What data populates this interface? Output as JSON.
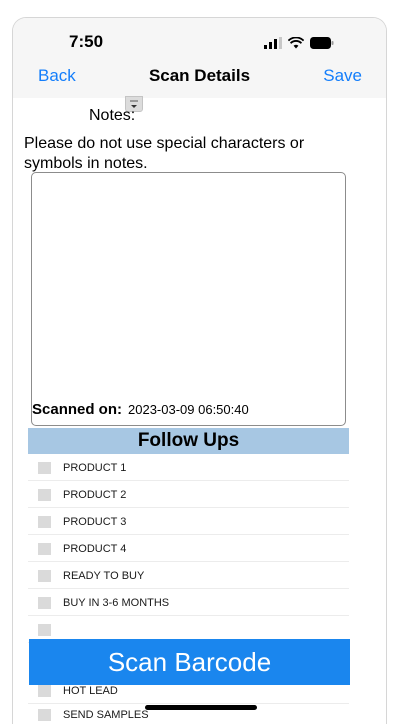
{
  "status_bar": {
    "time": "7:50"
  },
  "nav": {
    "back_label": "Back",
    "title": "Scan Details",
    "save_label": "Save"
  },
  "notes": {
    "label": "Notes:",
    "help_text": "Please do not use special characters or symbols in notes.",
    "value": ""
  },
  "scanned": {
    "label": "Scanned  on:",
    "value": "2023-03-09 06:50:40"
  },
  "followups": {
    "title": "Follow Ups",
    "items": [
      {
        "label": "PRODUCT 1",
        "checked": false
      },
      {
        "label": "PRODUCT 2",
        "checked": false
      },
      {
        "label": "PRODUCT 3",
        "checked": false
      },
      {
        "label": "PRODUCT 4",
        "checked": false
      },
      {
        "label": "READY TO BUY",
        "checked": false
      },
      {
        "label": "BUY IN 3-6 MONTHS",
        "checked": false
      },
      {
        "label": "HOT LEAD",
        "checked": false
      },
      {
        "label": "SEND SAMPLES",
        "checked": false
      }
    ]
  },
  "scan_button": {
    "label": "Scan Barcode"
  },
  "colors": {
    "accent": "#147efb",
    "followups_bg": "#a7c7e3",
    "scan_button_bg": "#1a86ee"
  },
  "icons": [
    "signal-icon",
    "wifi-icon",
    "battery-icon",
    "chevron-down-icon"
  ]
}
